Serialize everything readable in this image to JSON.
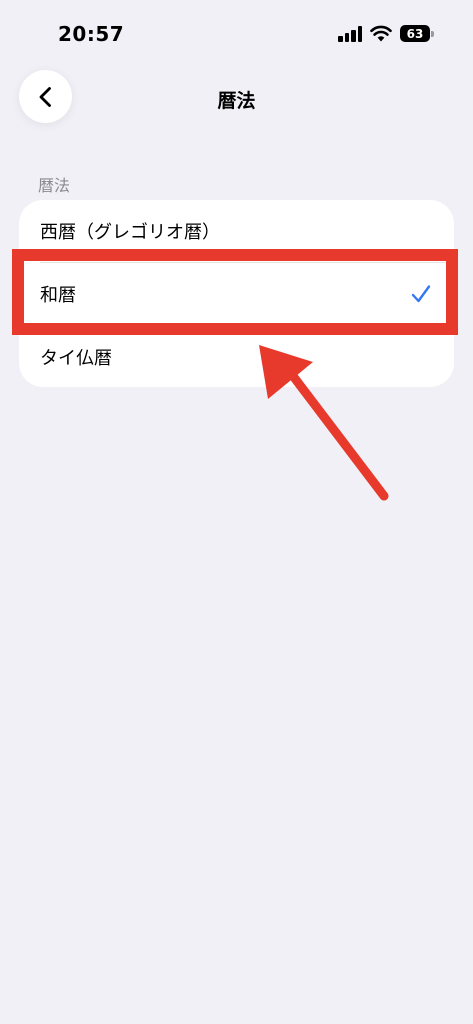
{
  "status_bar": {
    "time": "20:57",
    "battery": "63",
    "icons": [
      "signal-icon",
      "wifi-icon",
      "battery-icon"
    ]
  },
  "nav": {
    "back_icon": "chevron-left-icon",
    "title": "暦法"
  },
  "section": {
    "header": "暦法",
    "items": [
      {
        "label": "西暦（グレゴリオ暦）",
        "selected": false
      },
      {
        "label": "和暦",
        "selected": true
      },
      {
        "label": "タイ仏暦",
        "selected": false
      }
    ]
  },
  "colors": {
    "background": "#f1f0f6",
    "card": "#ffffff",
    "accent_check": "#3478f6",
    "annotation_red": "#e83a2c",
    "secondary_text": "#8a8a8f"
  }
}
